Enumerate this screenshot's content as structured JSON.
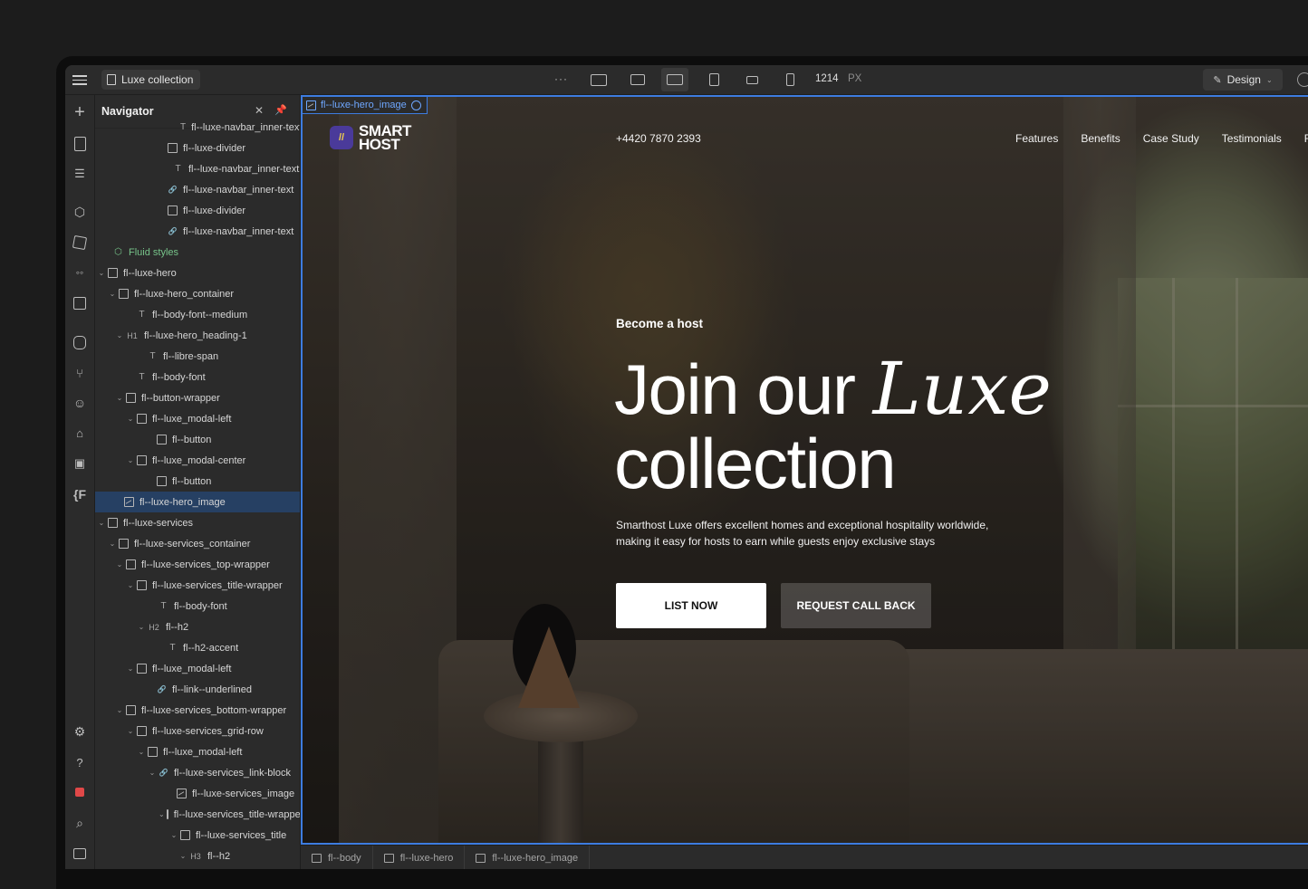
{
  "topbar": {
    "page_name": "Luxe collection",
    "more": "···",
    "width_value": "1214",
    "width_unit": "PX",
    "mode_label": "Design"
  },
  "navigator": {
    "title": "Navigator",
    "close": "✕",
    "rows": [
      {
        "label": "fl--luxe-navbar_inner-text",
        "icon": "text"
      },
      {
        "label": "fl--luxe-divider",
        "icon": "box"
      },
      {
        "label": "fl--luxe-navbar_inner-text",
        "icon": "text"
      },
      {
        "label": "fl--luxe-navbar_inner-text",
        "icon": "link"
      },
      {
        "label": "fl--luxe-divider",
        "icon": "box"
      },
      {
        "label": "fl--luxe-navbar_inner-text",
        "icon": "link"
      },
      {
        "label": "Fluid styles",
        "icon": "cube"
      },
      {
        "label": "fl--luxe-hero",
        "icon": "section"
      },
      {
        "label": "fl--luxe-hero_container",
        "icon": "box"
      },
      {
        "label": "fl--body-font--medium",
        "icon": "text"
      },
      {
        "label": "fl--luxe-hero_heading-1",
        "icon": "h1"
      },
      {
        "label": "fl--libre-span",
        "icon": "text"
      },
      {
        "label": "fl--body-font",
        "icon": "text"
      },
      {
        "label": "fl--button-wrapper",
        "icon": "box"
      },
      {
        "label": "fl--luxe_modal-left",
        "icon": "box"
      },
      {
        "label": "fl--button",
        "icon": "button"
      },
      {
        "label": "fl--luxe_modal-center",
        "icon": "box"
      },
      {
        "label": "fl--button",
        "icon": "button"
      },
      {
        "label": "fl--luxe-hero_image",
        "icon": "image"
      },
      {
        "label": "fl--luxe-services",
        "icon": "section"
      },
      {
        "label": "fl--luxe-services_container",
        "icon": "box"
      },
      {
        "label": "fl--luxe-services_top-wrapper",
        "icon": "box"
      },
      {
        "label": "fl--luxe-services_title-wrapper",
        "icon": "box"
      },
      {
        "label": "fl--body-font",
        "icon": "text"
      },
      {
        "label": "fl--h2",
        "icon": "h2"
      },
      {
        "label": "fl--h2-accent",
        "icon": "text"
      },
      {
        "label": "fl--luxe_modal-left",
        "icon": "box"
      },
      {
        "label": "fl--link--underlined",
        "icon": "link"
      },
      {
        "label": "fl--luxe-services_bottom-wrapper",
        "icon": "box"
      },
      {
        "label": "fl--luxe-services_grid-row",
        "icon": "box"
      },
      {
        "label": "fl--luxe_modal-left",
        "icon": "box"
      },
      {
        "label": "fl--luxe-services_link-block",
        "icon": "link"
      },
      {
        "label": "fl--luxe-services_image",
        "icon": "image"
      },
      {
        "label": "fl--luxe-services_title-wrapper",
        "icon": "box"
      },
      {
        "label": "fl--luxe-services_title",
        "icon": "box"
      },
      {
        "label": "fl--h2",
        "icon": "h3"
      }
    ],
    "tags": {
      "h1": "H1",
      "h2": "H2",
      "h3": "H3"
    }
  },
  "canvas": {
    "selected_element": "fl--luxe-hero_image",
    "logo_line1": "SMART",
    "logo_line2": "HOST",
    "phone": "+4420 7870 2393",
    "nav_links": [
      "Features",
      "Benefits",
      "Case Study",
      "Testimonials",
      "F"
    ],
    "eyebrow": "Become a host",
    "heading_part1": "Join our ",
    "heading_accent": "Luxe",
    "heading_part2": "collection",
    "paragraph": "Smarthost Luxe offers excellent homes and exceptional hospitality worldwide, making it easy for hosts to earn while guests enjoy exclusive stays",
    "button_primary": "LIST NOW",
    "button_secondary": "REQUEST CALL BACK"
  },
  "breadcrumbs": [
    "fl--body",
    "fl--luxe-hero",
    "fl--luxe-hero_image"
  ],
  "colors": {
    "selection_blue": "#3d7ce0",
    "fluid_green": "#77c48a",
    "selected_row": "#264063"
  }
}
